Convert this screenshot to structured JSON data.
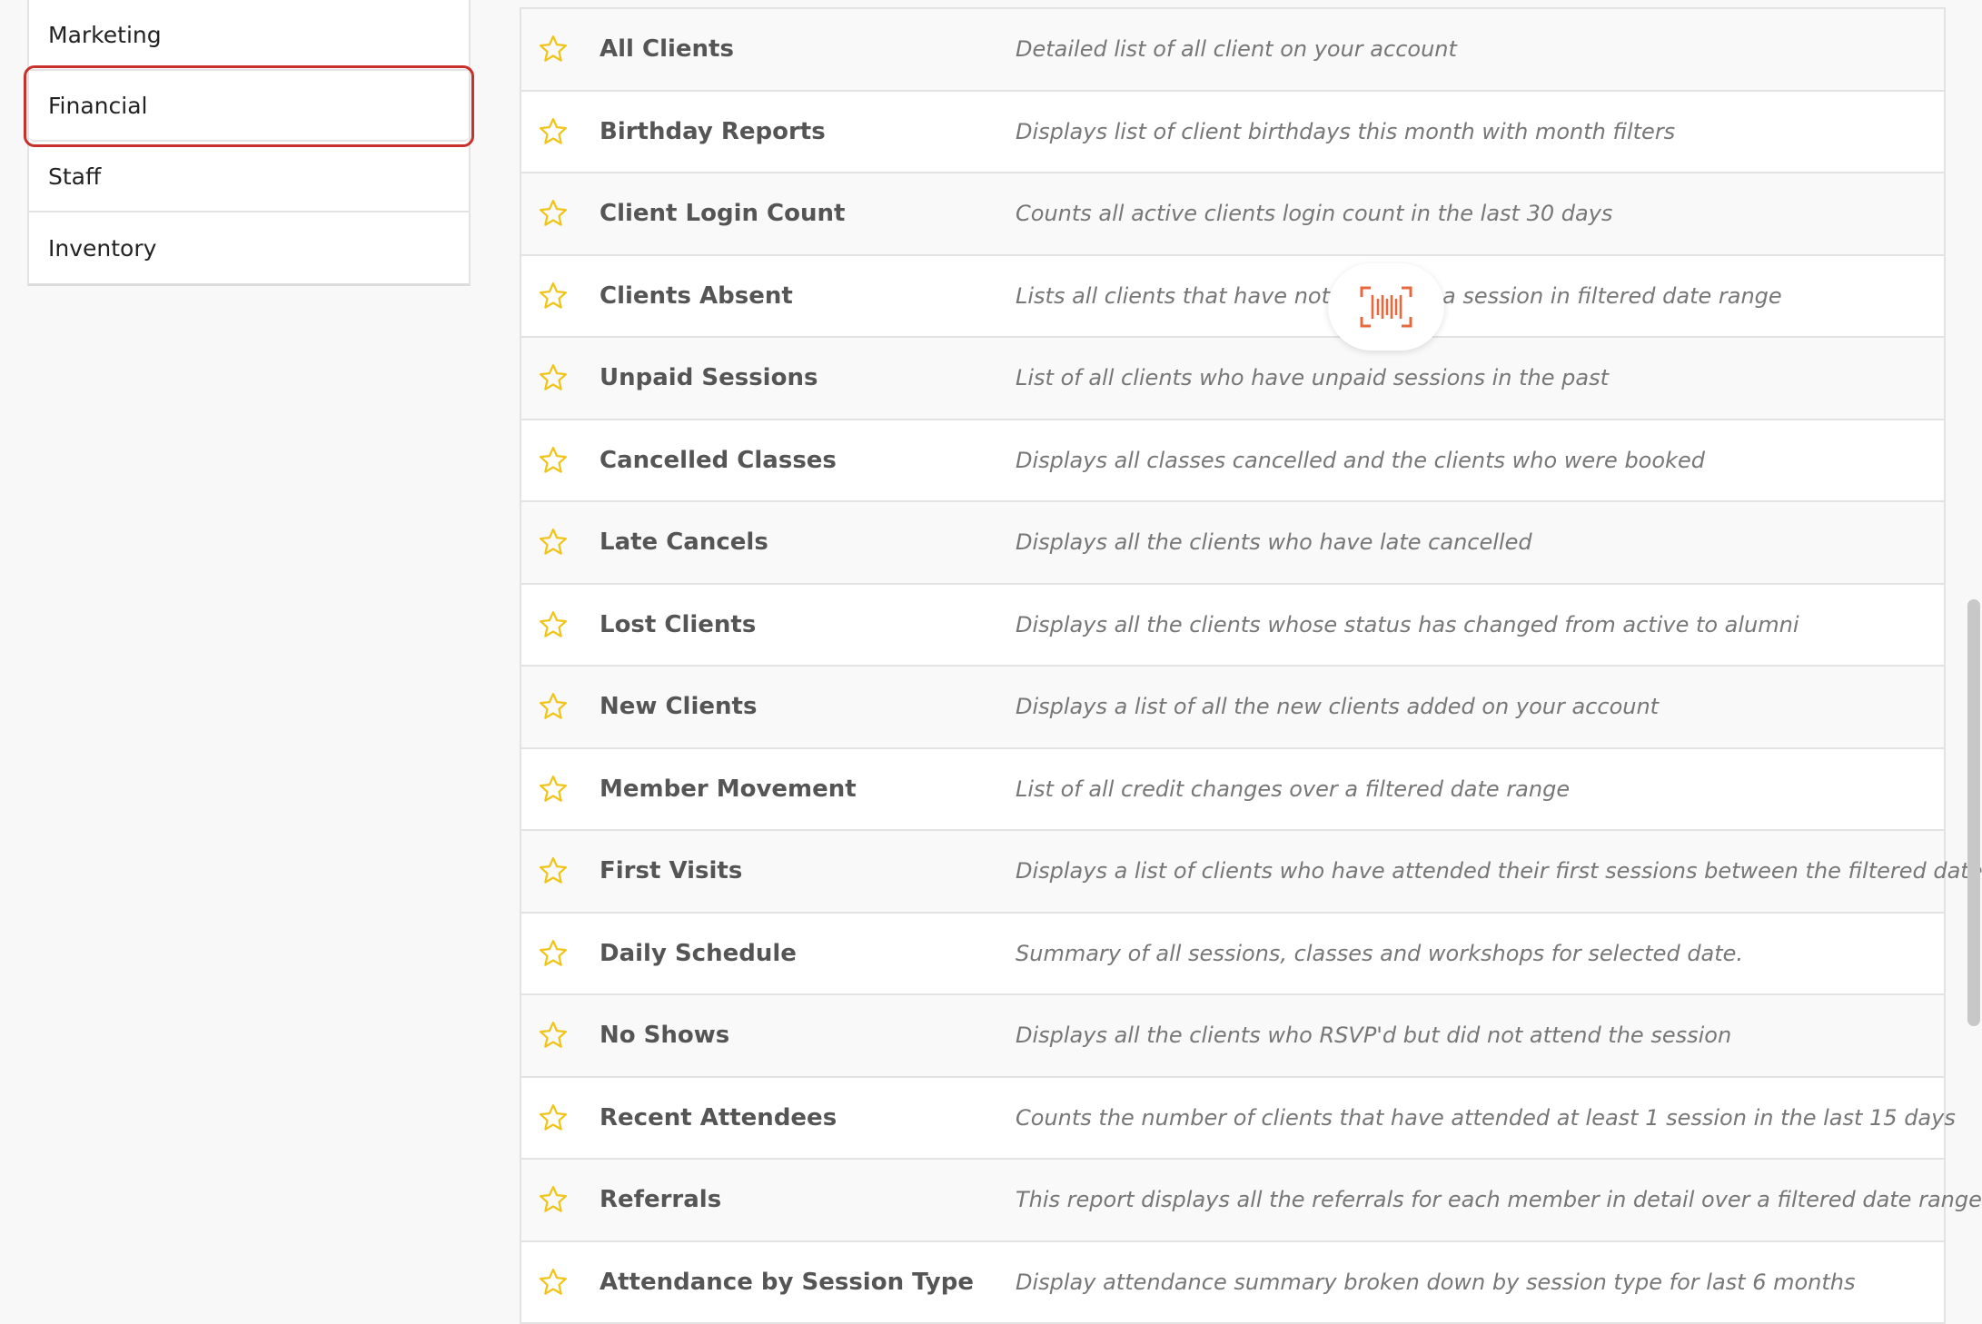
{
  "sidebar": {
    "items": [
      {
        "label": "Marketing"
      },
      {
        "label": "Financial",
        "active": true
      },
      {
        "label": "Staff"
      },
      {
        "label": "Inventory"
      }
    ]
  },
  "reports": [
    {
      "name": "All Clients",
      "desc": "Detailed list of all client on your account"
    },
    {
      "name": "Birthday Reports",
      "desc": "Displays list of client birthdays this month with month filters"
    },
    {
      "name": "Client Login Count",
      "desc": "Counts all active clients login count in the last 30 days"
    },
    {
      "name": "Clients Absent",
      "desc": "Lists all clients that have not attended a session in filtered date range"
    },
    {
      "name": "Unpaid Sessions",
      "desc": "List of all clients who have unpaid sessions in the past"
    },
    {
      "name": "Cancelled Classes",
      "desc": "Displays all classes cancelled and the clients who were booked"
    },
    {
      "name": "Late Cancels",
      "desc": "Displays all the clients who have late cancelled"
    },
    {
      "name": "Lost Clients",
      "desc": "Displays all the clients whose status has changed from active to alumni"
    },
    {
      "name": "New Clients",
      "desc": "Displays a list of all the new clients added on your account"
    },
    {
      "name": "Member Movement",
      "desc": "List of all credit changes over a filtered date range"
    },
    {
      "name": "First Visits",
      "desc": "Displays a list of clients who have attended their first sessions between the filtered date ranges."
    },
    {
      "name": "Daily Schedule",
      "desc": "Summary of all sessions, classes and workshops for selected date."
    },
    {
      "name": "No Shows",
      "desc": "Displays all the clients who RSVP'd but did not attend the session"
    },
    {
      "name": "Recent Attendees",
      "desc": "Counts the number of clients that have attended at least 1 session in the last 15 days"
    },
    {
      "name": "Referrals",
      "desc": "This report displays all the referrals for each member in detail over a filtered date range"
    },
    {
      "name": "Attendance by Session Type",
      "desc": "Display attendance summary broken down by session type for last 6 months"
    }
  ],
  "icons": {
    "favorite": "star-outline-icon",
    "scan": "barcode-scan-icon"
  },
  "colors": {
    "star": "#f0c419",
    "active_outline": "#c9302c",
    "barcode": "#e8673c"
  }
}
